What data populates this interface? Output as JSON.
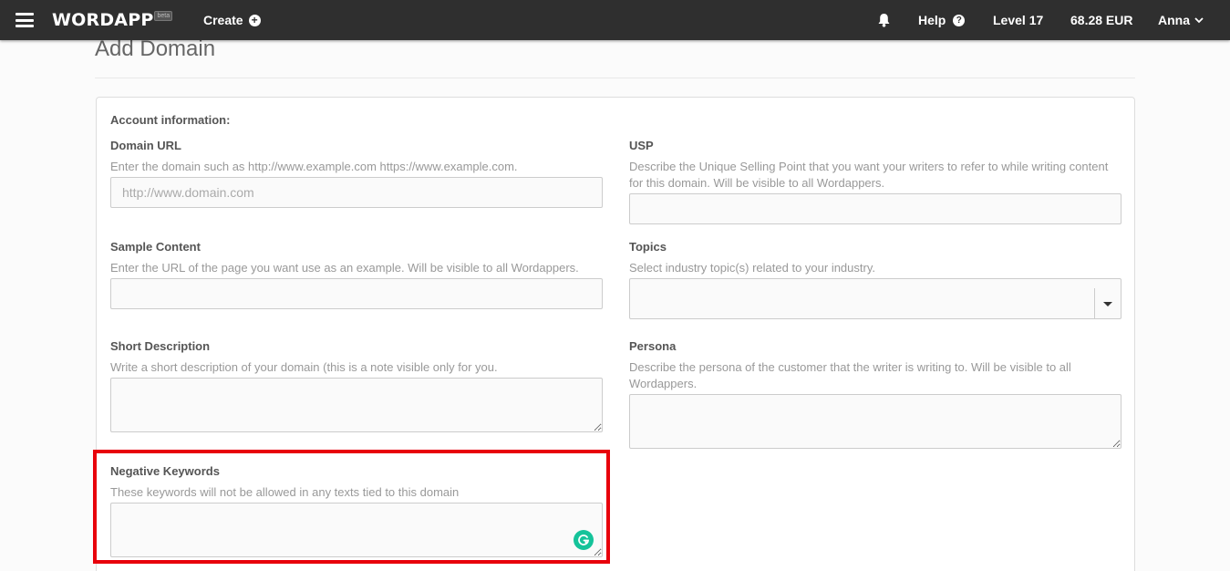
{
  "navbar": {
    "logo": "WORDAPP",
    "logo_badge": "beta",
    "create_label": "Create",
    "help_label": "Help",
    "level_label": "Level 17",
    "balance_label": "68.28 EUR",
    "user_label": "Anna"
  },
  "page": {
    "title": "Add Domain"
  },
  "form": {
    "section_heading": "Account information:",
    "domain_url": {
      "label": "Domain URL",
      "help": "Enter the domain such as http://www.example.com https://www.example.com.",
      "placeholder": "http://www.domain.com",
      "value": ""
    },
    "usp": {
      "label": "USP",
      "help": "Describe the Unique Selling Point that you want your writers to refer to while writing content for this domain. Will be visible to all Wordappers.",
      "value": ""
    },
    "sample_content": {
      "label": "Sample Content",
      "help": "Enter the URL of the page you want use as an example. Will be visible to all Wordappers.",
      "value": ""
    },
    "topics": {
      "label": "Topics",
      "help": "Select industry topic(s) related to your industry.",
      "value": ""
    },
    "short_description": {
      "label": "Short Description",
      "help": "Write a short description of your domain (this is a note visible only for you.",
      "value": ""
    },
    "persona": {
      "label": "Persona",
      "help": "Describe the persona of the customer that the writer is writing to. Will be visible to all Wordappers.",
      "value": ""
    },
    "negative_keywords": {
      "label": "Negative Keywords",
      "help": "These keywords will not be allowed in any texts tied to this domain",
      "value": ""
    }
  },
  "colors": {
    "navbar_bg": "#2f2f2f",
    "highlight": "#e8000b",
    "grammarly": "#15c39a"
  }
}
